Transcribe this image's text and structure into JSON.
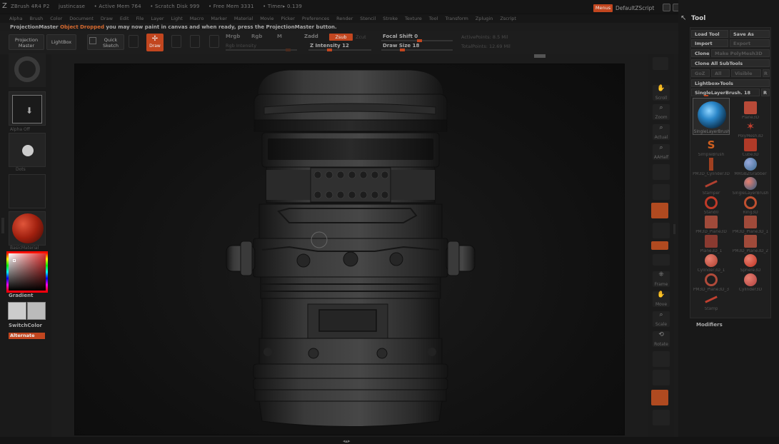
{
  "titlebar": {
    "app": "ZBrush 4R4 P2",
    "file": "justincase",
    "active_mem": "• Active Mem 764",
    "scratch_disk": "• Scratch Disk 999",
    "free_mem": "• Free Mem 3331",
    "timer": "• Timer▸ 0.139",
    "menus_button": "Menus",
    "default_script": "DefaultZScript"
  },
  "menubar": {
    "items": [
      "Alpha",
      "Brush",
      "Color",
      "Document",
      "Draw",
      "Edit",
      "File",
      "Layer",
      "Light",
      "Macro",
      "Marker",
      "Material",
      "Movie",
      "Picker",
      "Preferences",
      "Render",
      "Stencil",
      "Stroke",
      "Texture",
      "Tool",
      "Transform",
      "Zplugin",
      "Zscript"
    ]
  },
  "message": {
    "prefix": "ProjectionMaster",
    "highlight": "Object Dropped",
    "suffix": "you may now paint in canvas and when ready, press the ProjectionMaster button."
  },
  "shelf": {
    "projection_master": "Projection Master",
    "lightbox": "LightBox",
    "quick_sketch": "Quick Sketch",
    "draw": "Draw",
    "mrgb": "Mrgb",
    "rgb": "Rgb",
    "m": "M",
    "rgb_intensity": "Rgb Intensity",
    "zadd": "Zadd",
    "zsub": "Zsub",
    "zcut": "Zcut",
    "z_intensity": "Z Intensity 12",
    "focal_shift": "Focal Shift 0",
    "draw_size": "Draw Size 18",
    "active_points": "ActivePoints: 8.5 Mil",
    "total_points": "TotalPoints: 12.69 Mil"
  },
  "left": {
    "alpha_label": "Alpha Off",
    "stroke_label": "Dots",
    "material_label": "BasicMaterial",
    "gradient": "Gradient",
    "switch_color": "SwitchColor",
    "alternate": "Alternate"
  },
  "right_shelf": {
    "scroll": "Scroll",
    "zoom": "Zoom",
    "actual": "Actual",
    "aahalf": "AAHalf",
    "frame": "Frame",
    "move": "Move",
    "scale": "Scale",
    "rotate": "Rotate"
  },
  "tool": {
    "header": "Tool",
    "load_tool": "Load Tool",
    "save_as": "Save As",
    "import": "Import",
    "export": "Export",
    "clone": "Clone",
    "make_polymesh": "Make PolyMesh3D",
    "clone_all": "Clone All SubTools",
    "goz": "GoZ",
    "all": "All",
    "visible": "Visible",
    "r": "R",
    "lightbox_tools": "Lightbox▸Tools",
    "current_tool": "SingleLayerBrush. 18",
    "r2": "R",
    "thumbs": [
      "SingleLayerBrush",
      "Plane3D",
      "PolyMesh3D",
      "SimpleBrush",
      "Cube3D",
      "PM3D_Cylinder3D",
      "MRGBZGrabber",
      "Stamper",
      "SingleLayerBrush",
      "Stand0",
      "Ring3D",
      "PM3D_Plane3D",
      "PM3D_Plane3D_1",
      "Plane3D_1",
      "PM3D_Plane3D_2",
      "Cylinder3D_1",
      "Sphere3D",
      "PM3D_Plane3D_3",
      "Cylinder3D",
      "Stamp"
    ],
    "modifiers": "Modifiers"
  },
  "colors": {
    "accent": "#c2461f",
    "panel": "#181818"
  }
}
